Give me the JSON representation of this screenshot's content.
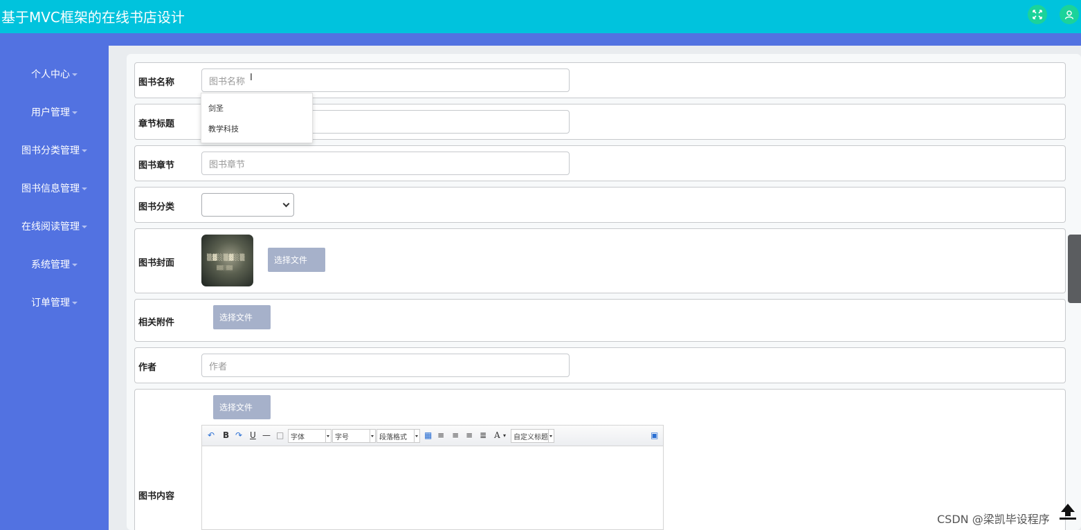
{
  "app": {
    "title": "基于MVC框架的在线书店设计",
    "header_icons": [
      "fullscreen-icon",
      "user-icon"
    ],
    "colors": {
      "header": "#00c3dd",
      "sidebar": "#5272e1",
      "icon_button": "#1bd39a",
      "file_button": "#a6b1ca"
    }
  },
  "sidebar": {
    "items": [
      {
        "label": "个人中心"
      },
      {
        "label": "用户管理"
      },
      {
        "label": "图书分类管理"
      },
      {
        "label": "图书信息管理"
      },
      {
        "label": "在线阅读管理"
      },
      {
        "label": "系统管理"
      },
      {
        "label": "订单管理"
      }
    ]
  },
  "form": {
    "book_name": {
      "label": "图书名称",
      "placeholder": "图书名称"
    },
    "autocomplete": [
      "剑圣",
      "教学科技"
    ],
    "chapter_title": {
      "label": "章节标题"
    },
    "chapter": {
      "label": "图书章节",
      "placeholder": "图书章节"
    },
    "category": {
      "label": "图书分类",
      "value": ""
    },
    "cover": {
      "label": "图书封面",
      "button": "选择文件"
    },
    "attachment": {
      "label": "相关附件",
      "button": "选择文件"
    },
    "author": {
      "label": "作者",
      "placeholder": "作者"
    },
    "content": {
      "label": "图书内容",
      "button": "选择文件"
    }
  },
  "editor_toolbar": {
    "selects": [
      "字体",
      "字号",
      "段落格式",
      "自定义标题"
    ],
    "buttons": [
      "undo",
      "bold",
      "redo",
      "underline",
      "horizontal-rule",
      "paste-plain",
      "table",
      "align-left",
      "align-right",
      "align-center",
      "justify",
      "font-color",
      "preview"
    ],
    "glyphs": {
      "bold": "B",
      "underline": "U",
      "font_color": "A"
    }
  },
  "watermark": "CSDN @梁凯毕设程序"
}
